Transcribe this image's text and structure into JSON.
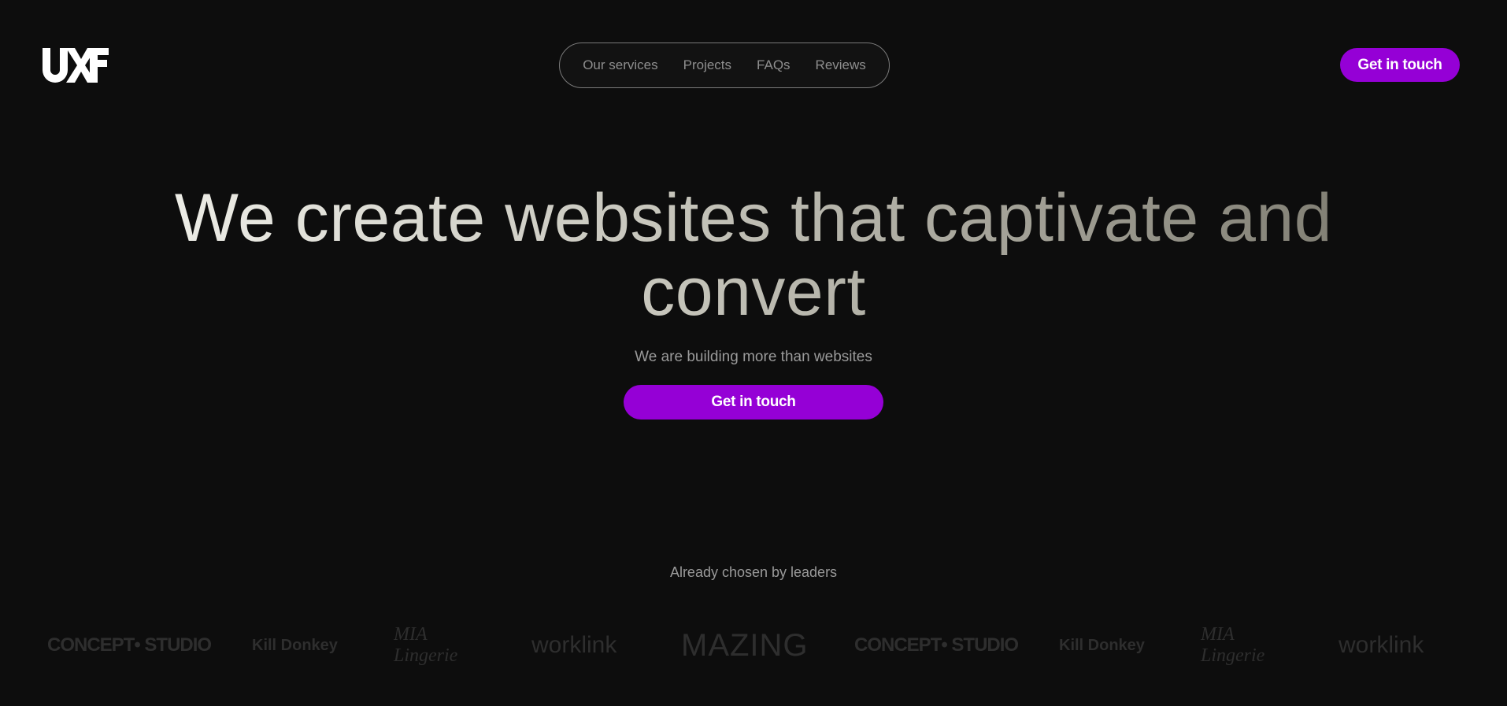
{
  "header": {
    "logo": "UXF",
    "nav": [
      "Our services",
      "Projects",
      "FAQs",
      "Reviews"
    ],
    "cta": "Get in touch"
  },
  "hero": {
    "title": "We create websites that captivate and convert",
    "subtitle": "We are building more than websites",
    "cta": "Get in touch"
  },
  "clients": {
    "heading": "Already chosen by leaders",
    "logos": [
      "CONCEPT• STUDIO",
      "Kill Donkey",
      "MIA Lingerie",
      "worklink",
      "MAZING",
      "CONCEPT• STUDIO",
      "Kill Donkey",
      "MIA Lingerie",
      "worklink"
    ]
  },
  "colors": {
    "background": "#0d0d0d",
    "accent": "#9500d6"
  }
}
